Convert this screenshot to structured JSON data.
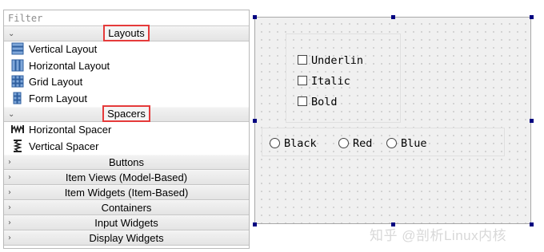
{
  "widget_box": {
    "filter_placeholder": "Filter",
    "categories": [
      {
        "label": "Layouts",
        "expanded": true,
        "items": [
          {
            "label": "Vertical Layout",
            "icon": "vertical-layout-icon"
          },
          {
            "label": "Horizontal Layout",
            "icon": "horizontal-layout-icon"
          },
          {
            "label": "Grid Layout",
            "icon": "grid-layout-icon"
          },
          {
            "label": "Form Layout",
            "icon": "form-layout-icon"
          }
        ]
      },
      {
        "label": "Spacers",
        "expanded": true,
        "items": [
          {
            "label": "Horizontal Spacer",
            "icon": "horizontal-spacer-icon"
          },
          {
            "label": "Vertical Spacer",
            "icon": "vertical-spacer-icon"
          }
        ]
      },
      {
        "label": "Buttons",
        "expanded": false
      },
      {
        "label": "Item Views (Model-Based)",
        "expanded": false
      },
      {
        "label": "Item Widgets (Item-Based)",
        "expanded": false
      },
      {
        "label": "Containers",
        "expanded": false
      },
      {
        "label": "Input Widgets",
        "expanded": false
      },
      {
        "label": "Display Widgets",
        "expanded": false
      }
    ],
    "highlight_color": "#e53a3a"
  },
  "form": {
    "checkboxes": [
      {
        "label": "Underlin",
        "checked": false
      },
      {
        "label": "Italic",
        "checked": false
      },
      {
        "label": "Bold",
        "checked": false
      }
    ],
    "radios": [
      {
        "label": "Black",
        "checked": false
      },
      {
        "label": "Red",
        "checked": false
      },
      {
        "label": "Blue",
        "checked": false
      }
    ],
    "selection_handle_color": "#000080"
  },
  "watermark": "知乎 @剖析Linux内核"
}
